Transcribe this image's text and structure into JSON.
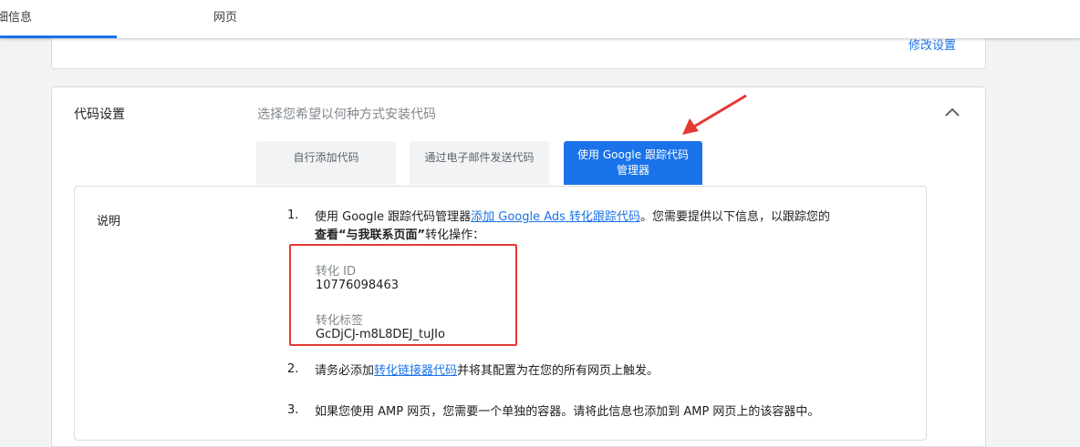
{
  "tabs": {
    "details": "细信息",
    "web": "网页"
  },
  "summary_card": {
    "edit_link": "修改设置"
  },
  "code_settings": {
    "title": "代码设置",
    "subtitle": "选择您希望以何种方式安装代码",
    "methods": [
      "自行添加代码",
      "通过电子邮件发送代码",
      "使用 Google 跟踪代码管理器"
    ],
    "instructions": {
      "title": "说明",
      "step1": {
        "num": "1.",
        "text_a": "使用 Google 跟踪代码管理器",
        "link": "添加 Google Ads 转化跟踪代码",
        "text_b": "。您需要提供以下信息，以跟踪您的",
        "bold": "查看“与我联系页面”",
        "text_c": "转化操作："
      },
      "conversion_id_label": "转化 ID",
      "conversion_id": "10776098463",
      "conversion_label_label": "转化标签",
      "conversion_label": "GcDjCJ-m8L8DEJ_tuJIo",
      "step2": {
        "num": "2.",
        "text_a": "请务必添加",
        "link": "转化链接器代码",
        "text_b": "并将其配置为在您的所有网页上触发。"
      },
      "step3": {
        "num": "3.",
        "text": "如果您使用 AMP 网页，您需要一个单独的容器。请将此信息也添加到 AMP 网页上的该容器中。"
      }
    }
  },
  "colors": {
    "accent": "#1a73e8",
    "annotation": "#e53935"
  },
  "icons": {
    "collapse": "chevron-up-icon",
    "annotation": "red-arrow"
  }
}
